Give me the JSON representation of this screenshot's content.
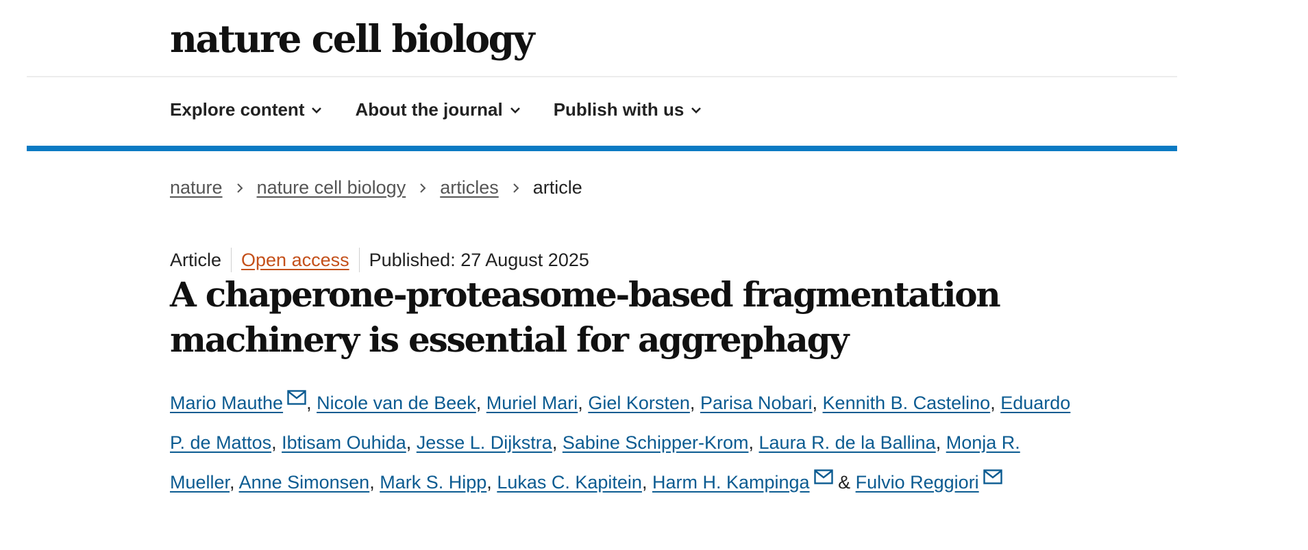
{
  "brand": {
    "logo_text": "nature cell biology"
  },
  "nav": {
    "items": [
      {
        "label": "Explore content"
      },
      {
        "label": "About the journal"
      },
      {
        "label": "Publish with us"
      }
    ]
  },
  "breadcrumb": {
    "items": [
      {
        "label": "nature"
      },
      {
        "label": "nature cell biology"
      },
      {
        "label": "articles"
      }
    ],
    "current": "article"
  },
  "article": {
    "type": "Article",
    "access": "Open access",
    "published": "Published: 27 August 2025",
    "title": "A chaperone-proteasome-based fragmentation machinery is essential for aggrephagy",
    "authors": [
      {
        "name": "Mario Mauthe",
        "corresponding": true
      },
      {
        "name": "Nicole van de Beek"
      },
      {
        "name": "Muriel Mari"
      },
      {
        "name": "Giel Korsten"
      },
      {
        "name": "Parisa Nobari"
      },
      {
        "name": "Kennith B. Castelino"
      },
      {
        "name": "Eduardo P. de Mattos"
      },
      {
        "name": "Ibtisam Ouhida"
      },
      {
        "name": "Jesse L. Dijkstra"
      },
      {
        "name": "Sabine Schipper-Krom"
      },
      {
        "name": "Laura R. de la Ballina"
      },
      {
        "name": "Monja R. Mueller"
      },
      {
        "name": "Anne Simonsen"
      },
      {
        "name": "Mark S. Hipp"
      },
      {
        "name": "Lukas C. Kapitein"
      },
      {
        "name": "Harm H. Kampinga",
        "corresponding": true
      },
      {
        "name": "Fulvio Reggiori",
        "corresponding": true
      }
    ],
    "separators": {
      "comma": ",",
      "ampersand": "&"
    }
  }
}
